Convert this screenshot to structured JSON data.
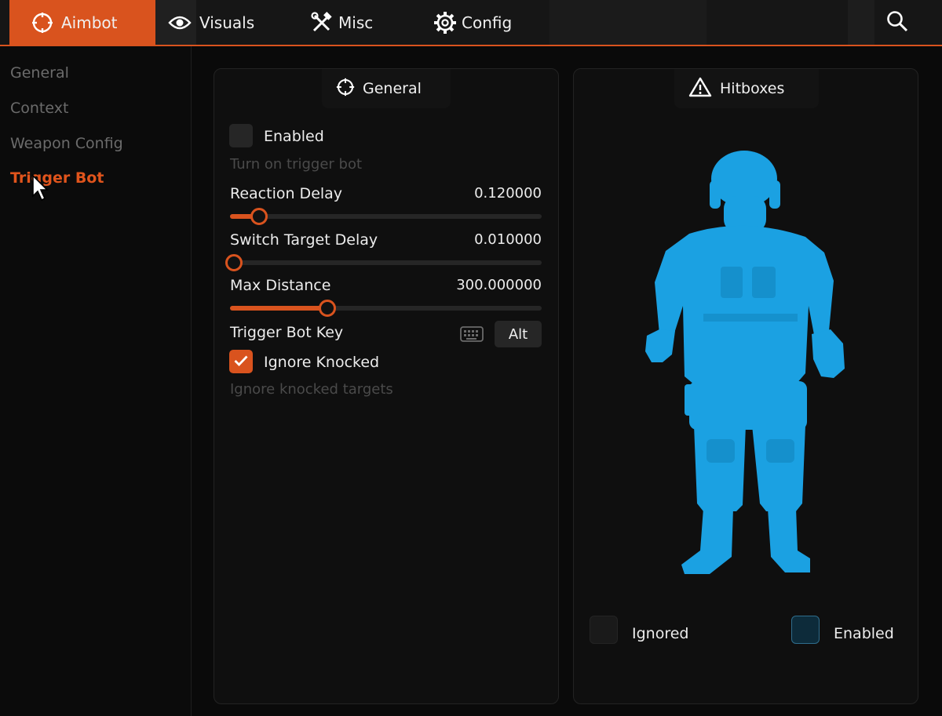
{
  "topbar": {
    "tabs": [
      {
        "label": "Aimbot",
        "icon": "crosshair-icon"
      },
      {
        "label": "Visuals",
        "icon": "eye-icon"
      },
      {
        "label": "Misc",
        "icon": "tools-icon"
      },
      {
        "label": "Config",
        "icon": "gear-icon"
      }
    ],
    "active_tab": "Aimbot",
    "search_icon": "search-icon"
  },
  "sidebar": {
    "items": [
      {
        "label": "General"
      },
      {
        "label": "Context"
      },
      {
        "label": "Weapon Config"
      },
      {
        "label": "Trigger Bot"
      }
    ],
    "active_item": "Trigger Bot"
  },
  "general_panel": {
    "title": "General",
    "icon": "crosshair-icon",
    "enabled": {
      "label": "Enabled",
      "description": "Turn on trigger bot",
      "checked": false
    },
    "sliders": [
      {
        "label": "Reaction Delay",
        "value": "0.120000",
        "fill": 0.08
      },
      {
        "label": "Switch Target Delay",
        "value": "0.010000",
        "fill": 0.0
      },
      {
        "label": "Max Distance",
        "value": "300.000000",
        "fill": 0.3
      }
    ],
    "trigger_key": {
      "label": "Trigger Bot Key",
      "key": "Alt",
      "icon": "keyboard-icon"
    },
    "ignore_knocked": {
      "label": "Ignore Knocked",
      "description": "Ignore knocked targets",
      "checked": true
    }
  },
  "hitbox_panel": {
    "title": "Hitboxes",
    "icon": "warning-icon",
    "legend": [
      {
        "label": "Ignored",
        "color": "#1a1a1a"
      },
      {
        "label": "Enabled",
        "color": "#0d2b3a"
      }
    ],
    "body_color": "#1ba1e2"
  },
  "colors": {
    "accent": "#d9531e",
    "background": "#0a0a0a",
    "panel": "#0f0f0f"
  }
}
